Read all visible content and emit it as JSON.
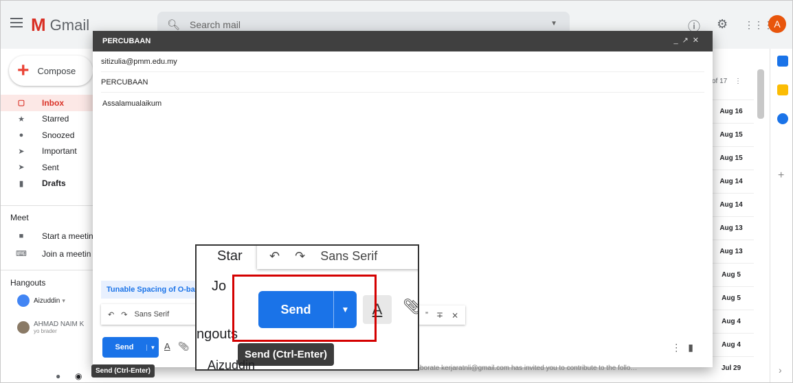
{
  "topbar": {
    "app_name": "Gmail",
    "logo_letter": "M",
    "search_placeholder": "Search mail",
    "avatar_letter": "A"
  },
  "sidebar": {
    "compose_label": "Compose",
    "items": [
      {
        "label": "Inbox"
      },
      {
        "label": "Starred"
      },
      {
        "label": "Snoozed"
      },
      {
        "label": "Important"
      },
      {
        "label": "Sent"
      },
      {
        "label": "Drafts"
      }
    ],
    "meet_title": "Meet",
    "meet_items": [
      {
        "label": "Start a meetin"
      },
      {
        "label": "Join a meetin"
      }
    ],
    "hangouts_title": "Hangouts",
    "hangouts_user": "Aizuddin",
    "hangouts_contact_name": "AHMAD NAIM K",
    "hangouts_contact_status": "yo brader"
  },
  "list": {
    "page_info": "of 17",
    "dates": [
      "Aug 16",
      "Aug 15",
      "Aug 15",
      "Aug 14",
      "Aug 14",
      "Aug 13",
      "Aug 13",
      "Aug 5",
      "Aug 5",
      "Aug 4",
      "Aug 4",
      "Jul 29"
    ],
    "bottom_snippet": "…borate  kerjaratnli@gmail.com has invited you to contribute to the follo…"
  },
  "compose": {
    "title": "PERCUBAAN",
    "to": "sitizulia@pmm.edu.my",
    "subject": "PERCUBAAN",
    "body": "Assalamualaikum",
    "suggestion": "Tunable Spacing of O-ba",
    "font": "Sans Serif",
    "send_label": "Send",
    "send_tooltip": "Send (Ctrl-Enter)"
  },
  "zoom": {
    "bg_start": "Star",
    "bg_join": "Jo",
    "bg_hangouts": "ngouts",
    "bg_user": "Aizuddin",
    "font": "Sans Serif",
    "send_label": "Send",
    "tooltip": "Send (Ctrl-Enter)"
  },
  "icons": [
    "menu-icon",
    "search-icon",
    "help-icon",
    "settings-icon",
    "apps-icon",
    "undo-icon",
    "redo-icon",
    "text-format-icon",
    "attach-icon",
    "quote-icon",
    "strikethrough-icon",
    "clear-format-icon",
    "more-options-icon",
    "trash-icon"
  ]
}
